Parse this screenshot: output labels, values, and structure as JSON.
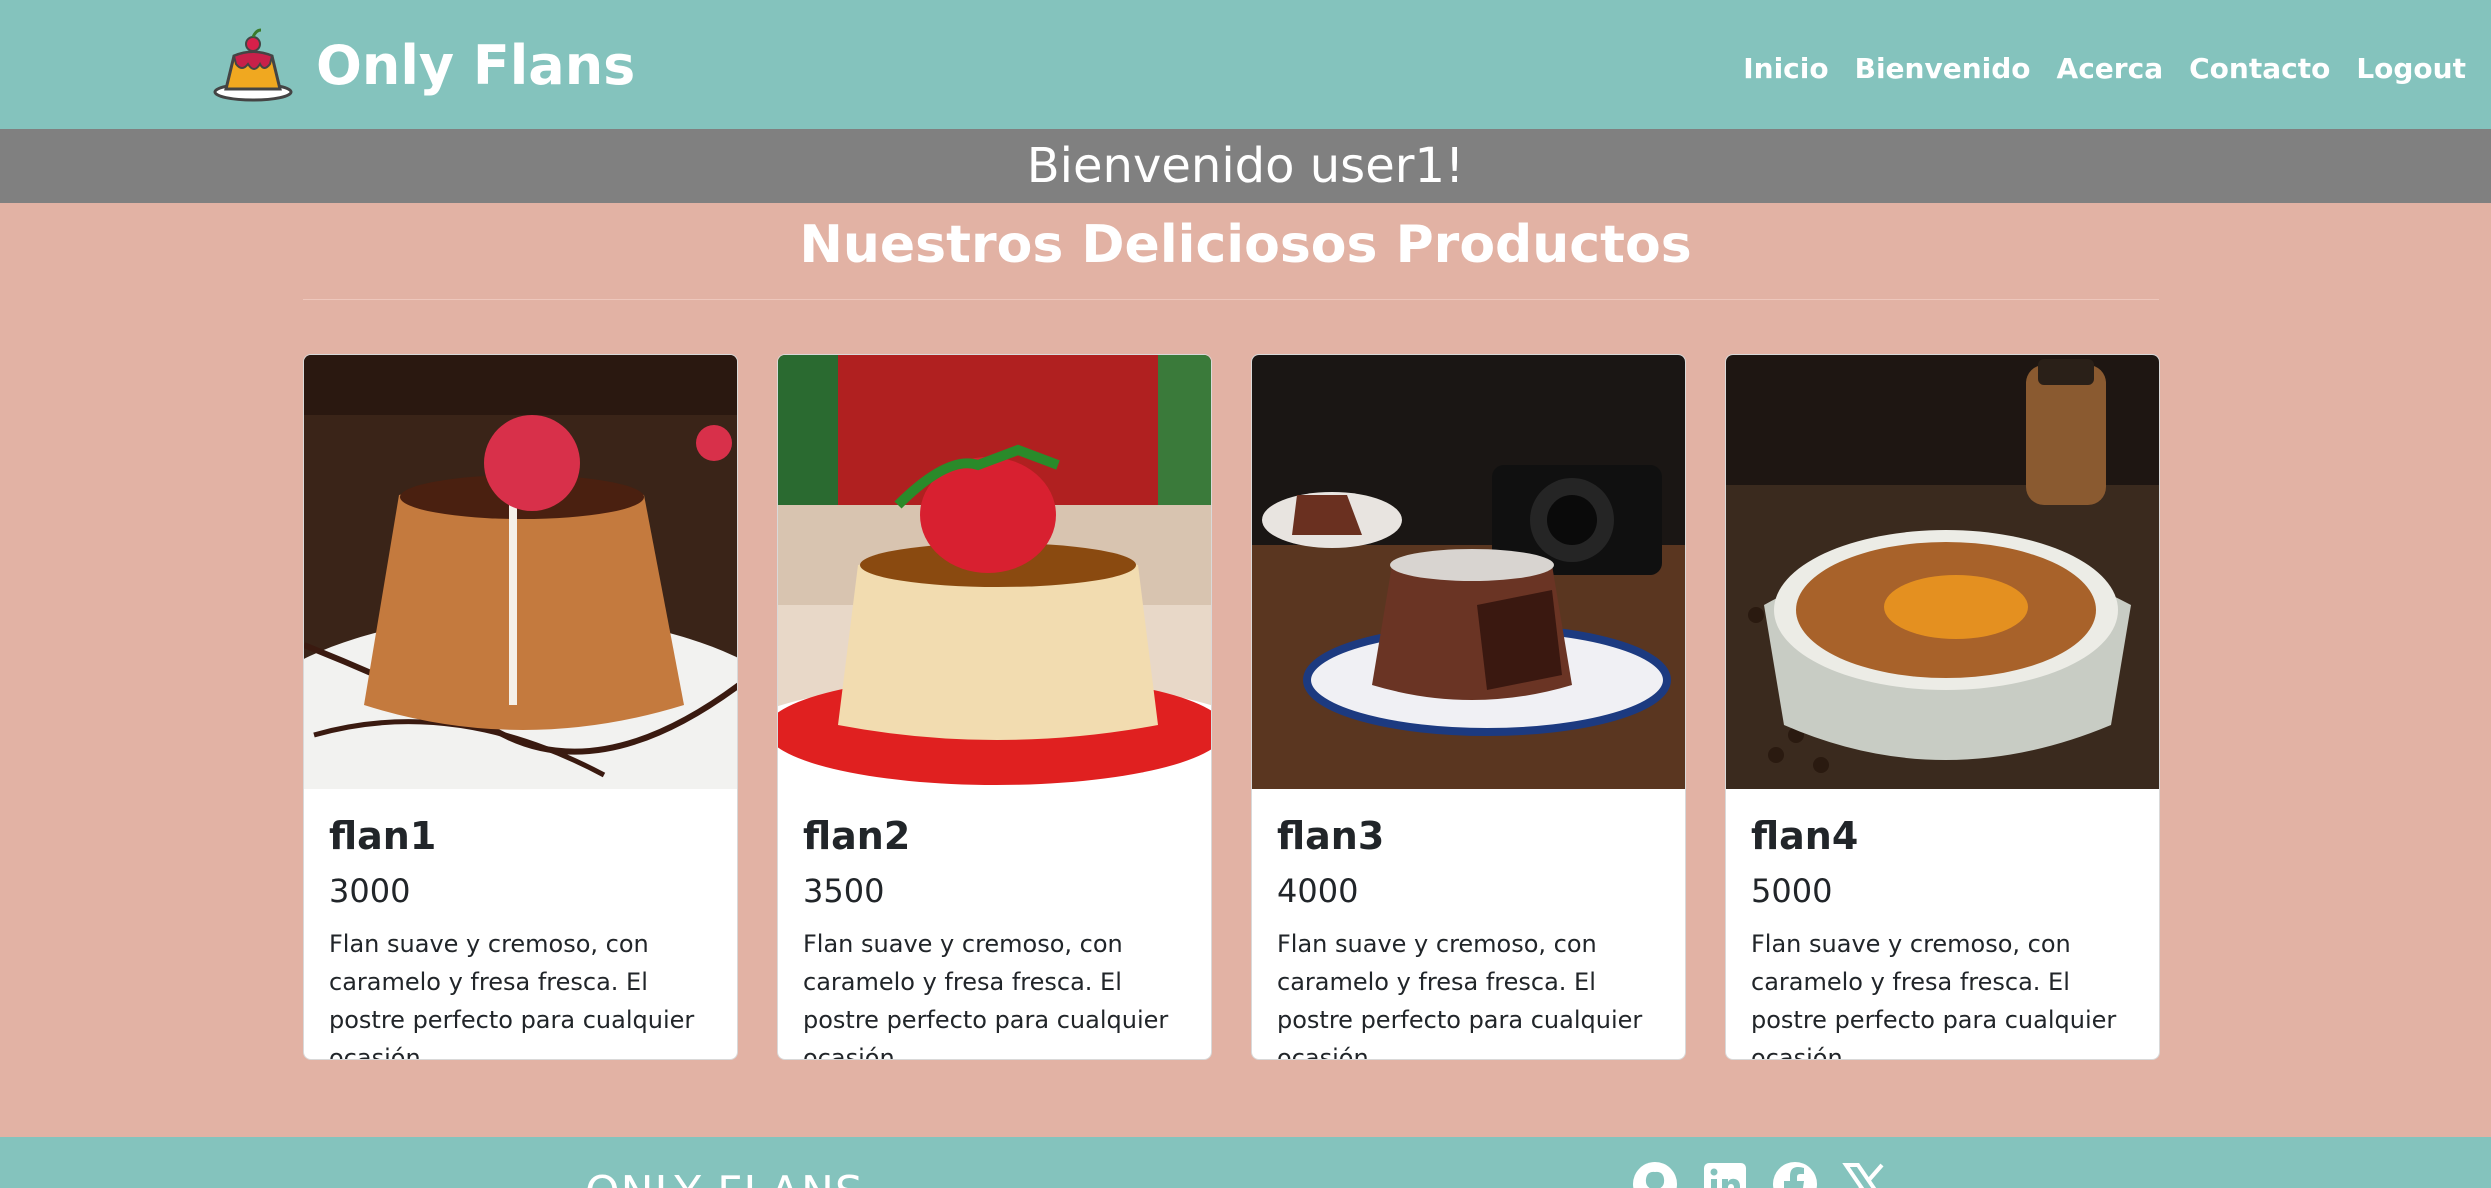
{
  "header": {
    "brand": "Only Flans",
    "nav": [
      "Inicio",
      "Bienvenido",
      "Acerca",
      "Contacto",
      "Logout"
    ]
  },
  "welcome": "Bienvenido user1!",
  "products_title": "Nuestros Deliciosos Productos",
  "products": [
    {
      "name": "flan1",
      "price": "3000",
      "description": "Flan suave y cremoso, con caramelo y fresa fresca. El postre perfecto para cualquier ocasión.",
      "image": "chocolate flan with raspberry on white plate"
    },
    {
      "name": "flan2",
      "price": "3500",
      "description": "Flan suave y cremoso, con caramelo y fresa fresca. El postre perfecto para cualquier ocasión.",
      "image": "caramel flan with strawberry on red sauce"
    },
    {
      "name": "flan3",
      "price": "4000",
      "description": "Flan suave y cremoso, con caramelo y fresa fresca. El postre perfecto para cualquier ocasión.",
      "image": "chocolate lava cake on blue plate with camera"
    },
    {
      "name": "flan4",
      "price": "5000",
      "description": "Flan suave y cremoso, con caramelo y fresa fresca. El postre perfecto para cualquier ocasión.",
      "image": "baked flan in white ramekin with coffee beans"
    }
  ],
  "footer": {
    "brand": "ONLY FLANS",
    "social_icons": [
      "github-icon",
      "linkedin-icon",
      "facebook-icon",
      "x-icon"
    ]
  },
  "colors": {
    "header_bg": "#84c3bd",
    "welcome_bg": "#808080",
    "page_bg": "#e2b2a4",
    "card_bg": "#ffffff"
  }
}
